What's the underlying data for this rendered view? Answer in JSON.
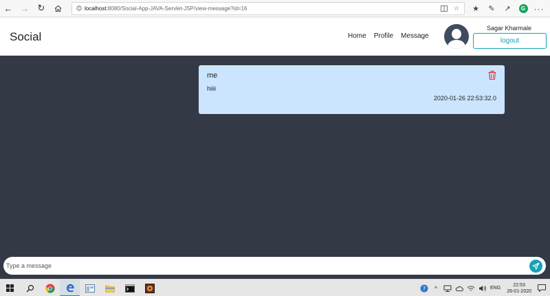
{
  "browser": {
    "url_host": "localhost",
    "url_path": ":8080/Social-App-JAVA-Servlet-JSP/view-message?id=16"
  },
  "header": {
    "brand": "Social",
    "nav": [
      "Home",
      "Profile",
      "Message"
    ],
    "user_name": "Sagar Kharmale",
    "logout_label": "logout"
  },
  "messages": [
    {
      "author": "me",
      "text": "hiiii",
      "timestamp": "2020-01-26 22:53:32.0"
    }
  ],
  "composer": {
    "placeholder": "Type a message"
  },
  "taskbar": {
    "language": "ENG",
    "time": "22:53",
    "date": "26-01-2020"
  },
  "colors": {
    "page_bg": "#343a45",
    "message_bg": "#cce5ff",
    "accent": "#17a2b8",
    "danger": "#dc3545"
  }
}
